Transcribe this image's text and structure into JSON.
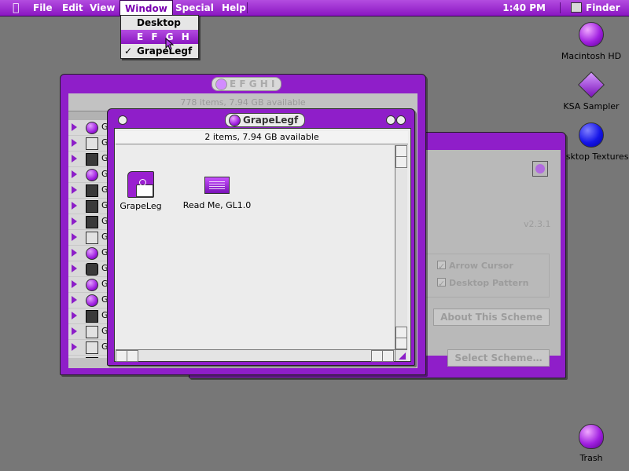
{
  "menubar": {
    "apple": "",
    "items": [
      "File",
      "Edit",
      "View",
      "Window",
      "Special",
      "Help"
    ],
    "clock": "1:40 PM",
    "app": "Finder"
  },
  "window_menu": {
    "items": [
      {
        "label": "Desktop",
        "checked": false,
        "selected": false
      },
      {
        "label": "E F G H I",
        "checked": false,
        "selected": true
      },
      {
        "label": "GrapeLegf",
        "checked": true,
        "selected": false
      }
    ]
  },
  "desktop_icons": [
    {
      "label": "Macintosh HD",
      "icon": "hard-drive-icon"
    },
    {
      "label": "KSA Sampler",
      "icon": "diamond-app-icon"
    },
    {
      "label": "Desktop Textures",
      "icon": "blue-sphere-icon"
    },
    {
      "label": "Trash",
      "icon": "trash-icon"
    }
  ],
  "scheme_window": {
    "version": "v2.3.1",
    "arrow_cursor": "Arrow Cursor",
    "desktop_pattern": "Desktop Pattern",
    "about_button": "About This Scheme",
    "select_button": "Select Scheme…"
  },
  "efghi_window": {
    "title": "E F G H I",
    "info": "778 items, 7.94 GB available",
    "row_label": "G"
  },
  "grape_window": {
    "title": "GrapeLegf",
    "info": "2 items, 7.94 GB available",
    "files": [
      {
        "label": "GrapeLeg",
        "icon": "purple-folder-icon"
      },
      {
        "label": "Read Me, GL1.0",
        "icon": "document-icon"
      }
    ]
  },
  "colors": {
    "accent": "#8f1ec9",
    "desktop": "#777777",
    "window_bg": "#ececec"
  }
}
